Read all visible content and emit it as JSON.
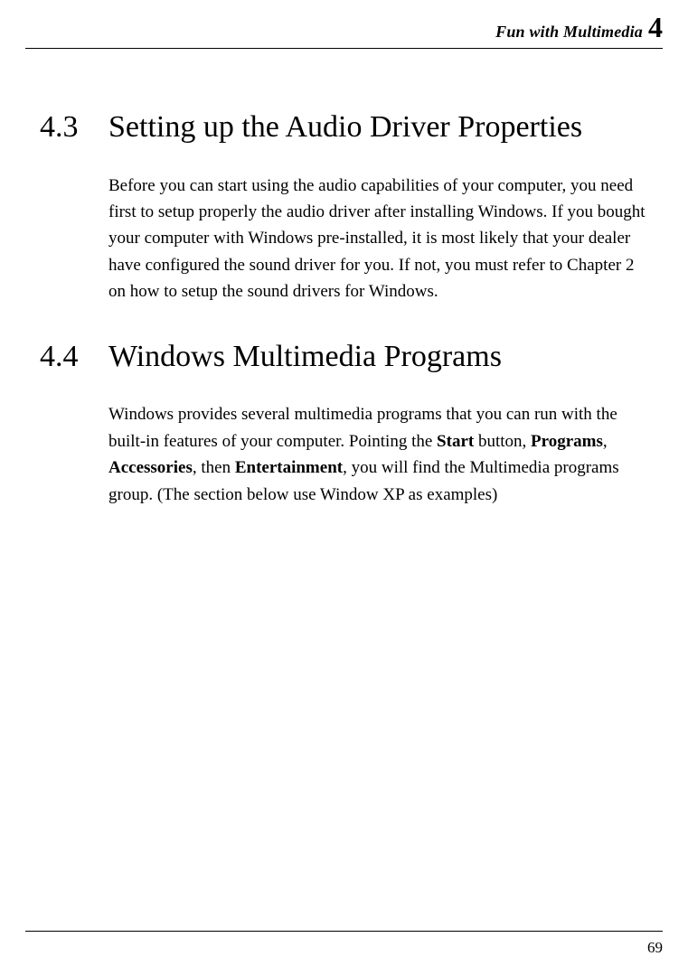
{
  "header": {
    "title": "Fun with Multimedia",
    "chapter_number": "4"
  },
  "sections": [
    {
      "number": "4.3",
      "title": "Setting up the Audio Driver Properties",
      "body_parts": [
        {
          "text": "Before you can start using the audio capabilities of your computer, you need first to setup properly the audio driver after installing Windows. If you bought your computer with Windows pre-installed, it is most likely that your dealer have configured the sound driver for you. If not, you must refer to Chapter 2 on how to setup the sound drivers for Windows.",
          "bold": false
        }
      ]
    },
    {
      "number": "4.4",
      "title": "Windows Multimedia Programs",
      "body_parts": [
        {
          "text": "Windows provides several multimedia programs that you can run with the built-in features of your computer. Pointing the ",
          "bold": false
        },
        {
          "text": "Start",
          "bold": true
        },
        {
          "text": " button, ",
          "bold": false
        },
        {
          "text": "Programs",
          "bold": true
        },
        {
          "text": ", ",
          "bold": false
        },
        {
          "text": "Accessories",
          "bold": true
        },
        {
          "text": ", then ",
          "bold": false
        },
        {
          "text": "Entertainment",
          "bold": true
        },
        {
          "text": ", you will find the Multimedia programs group. (The section below use Window XP as examples)",
          "bold": false
        }
      ]
    }
  ],
  "footer": {
    "page_number": "69"
  }
}
